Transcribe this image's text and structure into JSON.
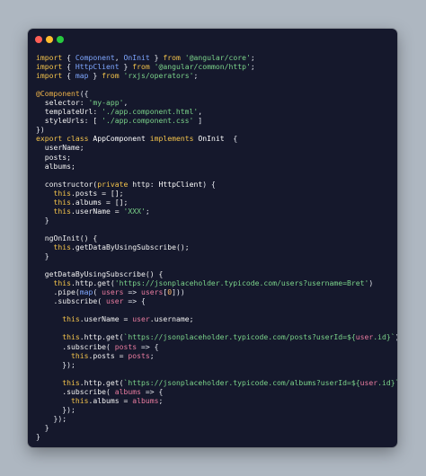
{
  "window": {
    "controls": [
      "close",
      "minimize",
      "zoom"
    ]
  },
  "code_lines": [
    [
      [
        "kw",
        "import"
      ],
      [
        "punc",
        " { "
      ],
      [
        "imp",
        "Component"
      ],
      [
        "punc",
        ", "
      ],
      [
        "imp",
        "OnInit"
      ],
      [
        "punc",
        " } "
      ],
      [
        "kw",
        "from"
      ],
      [
        "punc",
        " "
      ],
      [
        "str",
        "'@angular/core'"
      ],
      [
        "punc",
        ";"
      ]
    ],
    [
      [
        "kw",
        "import"
      ],
      [
        "punc",
        " { "
      ],
      [
        "imp",
        "HttpClient"
      ],
      [
        "punc",
        " } "
      ],
      [
        "kw",
        "from"
      ],
      [
        "punc",
        " "
      ],
      [
        "str",
        "'@angular/common/http'"
      ],
      [
        "punc",
        ";"
      ]
    ],
    [
      [
        "kw",
        "import"
      ],
      [
        "punc",
        " { "
      ],
      [
        "imp",
        "map"
      ],
      [
        "punc",
        " } "
      ],
      [
        "kw",
        "from"
      ],
      [
        "punc",
        " "
      ],
      [
        "str",
        "'rxjs/operators'"
      ],
      [
        "punc",
        ";"
      ]
    ],
    [],
    [
      [
        "dec",
        "@Component"
      ],
      [
        "punc",
        "({"
      ]
    ],
    [
      [
        "prop",
        "  selector: "
      ],
      [
        "str",
        "'my-app'"
      ],
      [
        "punc",
        ","
      ]
    ],
    [
      [
        "prop",
        "  templateUrl: "
      ],
      [
        "str",
        "'./app.component.html'"
      ],
      [
        "punc",
        ","
      ]
    ],
    [
      [
        "prop",
        "  styleUrls: [ "
      ],
      [
        "str",
        "'./app.component.css'"
      ],
      [
        "punc",
        " ]"
      ]
    ],
    [
      [
        "punc",
        "})"
      ]
    ],
    [
      [
        "kw",
        "export class"
      ],
      [
        "punc",
        " "
      ],
      [
        "cls",
        "AppComponent"
      ],
      [
        "punc",
        " "
      ],
      [
        "kw",
        "implements"
      ],
      [
        "punc",
        " "
      ],
      [
        "cls",
        "OnInit"
      ],
      [
        "punc",
        "  {"
      ]
    ],
    [
      [
        "prop",
        "  userName;"
      ]
    ],
    [
      [
        "prop",
        "  posts;"
      ]
    ],
    [
      [
        "prop",
        "  albums;"
      ]
    ],
    [],
    [
      [
        "prop",
        "  constructor("
      ],
      [
        "kw",
        "private"
      ],
      [
        "punc",
        " "
      ],
      [
        "prop",
        "http"
      ],
      [
        "punc",
        ": "
      ],
      [
        "cls",
        "HttpClient"
      ],
      [
        "punc",
        ") {"
      ]
    ],
    [
      [
        "punc",
        "    "
      ],
      [
        "kw",
        "this"
      ],
      [
        "prop",
        ".posts = [];"
      ]
    ],
    [
      [
        "punc",
        "    "
      ],
      [
        "kw",
        "this"
      ],
      [
        "prop",
        ".albums = [];"
      ]
    ],
    [
      [
        "punc",
        "    "
      ],
      [
        "kw",
        "this"
      ],
      [
        "prop",
        ".userName = "
      ],
      [
        "str",
        "'XXX'"
      ],
      [
        "punc",
        ";"
      ]
    ],
    [
      [
        "punc",
        "  }"
      ]
    ],
    [],
    [
      [
        "prop",
        "  ngOnInit() {"
      ]
    ],
    [
      [
        "punc",
        "    "
      ],
      [
        "kw",
        "this"
      ],
      [
        "prop",
        ".getDataByUsingSubscribe();"
      ]
    ],
    [
      [
        "punc",
        "  }"
      ]
    ],
    [],
    [
      [
        "prop",
        "  getDataByUsingSubscribe() {"
      ]
    ],
    [
      [
        "punc",
        "    "
      ],
      [
        "kw",
        "this"
      ],
      [
        "prop",
        ".http.get("
      ],
      [
        "str",
        "'https://jsonplaceholder.typicode.com/users?username=Bret'"
      ],
      [
        "punc",
        ")"
      ]
    ],
    [
      [
        "prop",
        "    .pipe("
      ],
      [
        "imp",
        "map"
      ],
      [
        "punc",
        "( "
      ],
      [
        "var",
        "users"
      ],
      [
        "punc",
        " => "
      ],
      [
        "var",
        "users"
      ],
      [
        "punc",
        "["
      ],
      [
        "num",
        "0"
      ],
      [
        "punc",
        "]))"
      ]
    ],
    [
      [
        "prop",
        "    .subscribe( "
      ],
      [
        "var",
        "user"
      ],
      [
        "punc",
        " => {"
      ]
    ],
    [],
    [
      [
        "punc",
        "      "
      ],
      [
        "kw",
        "this"
      ],
      [
        "prop",
        ".userName = "
      ],
      [
        "var",
        "user"
      ],
      [
        "prop",
        ".username;"
      ]
    ],
    [],
    [
      [
        "punc",
        "      "
      ],
      [
        "kw",
        "this"
      ],
      [
        "prop",
        ".http.get("
      ],
      [
        "str",
        "`https://jsonplaceholder.typicode.com/posts?userId=${"
      ],
      [
        "var",
        "user"
      ],
      [
        "str",
        ".id}`"
      ],
      [
        "punc",
        ")"
      ]
    ],
    [
      [
        "prop",
        "      .subscribe( "
      ],
      [
        "var",
        "posts"
      ],
      [
        "punc",
        " => {"
      ]
    ],
    [
      [
        "punc",
        "        "
      ],
      [
        "kw",
        "this"
      ],
      [
        "prop",
        ".posts = "
      ],
      [
        "var",
        "posts"
      ],
      [
        "punc",
        ";"
      ]
    ],
    [
      [
        "punc",
        "      });"
      ]
    ],
    [],
    [
      [
        "punc",
        "      "
      ],
      [
        "kw",
        "this"
      ],
      [
        "prop",
        ".http.get("
      ],
      [
        "str",
        "`https://jsonplaceholder.typicode.com/albums?userId=${"
      ],
      [
        "var",
        "user"
      ],
      [
        "str",
        ".id}`"
      ],
      [
        "punc",
        ")"
      ]
    ],
    [
      [
        "prop",
        "      .subscribe( "
      ],
      [
        "var",
        "albums"
      ],
      [
        "punc",
        " => {"
      ]
    ],
    [
      [
        "punc",
        "        "
      ],
      [
        "kw",
        "this"
      ],
      [
        "prop",
        ".albums = "
      ],
      [
        "var",
        "albums"
      ],
      [
        "punc",
        ";"
      ]
    ],
    [
      [
        "punc",
        "      });"
      ]
    ],
    [
      [
        "punc",
        "    });"
      ]
    ],
    [
      [
        "punc",
        "  }"
      ]
    ],
    [
      [
        "punc",
        "}"
      ]
    ]
  ]
}
